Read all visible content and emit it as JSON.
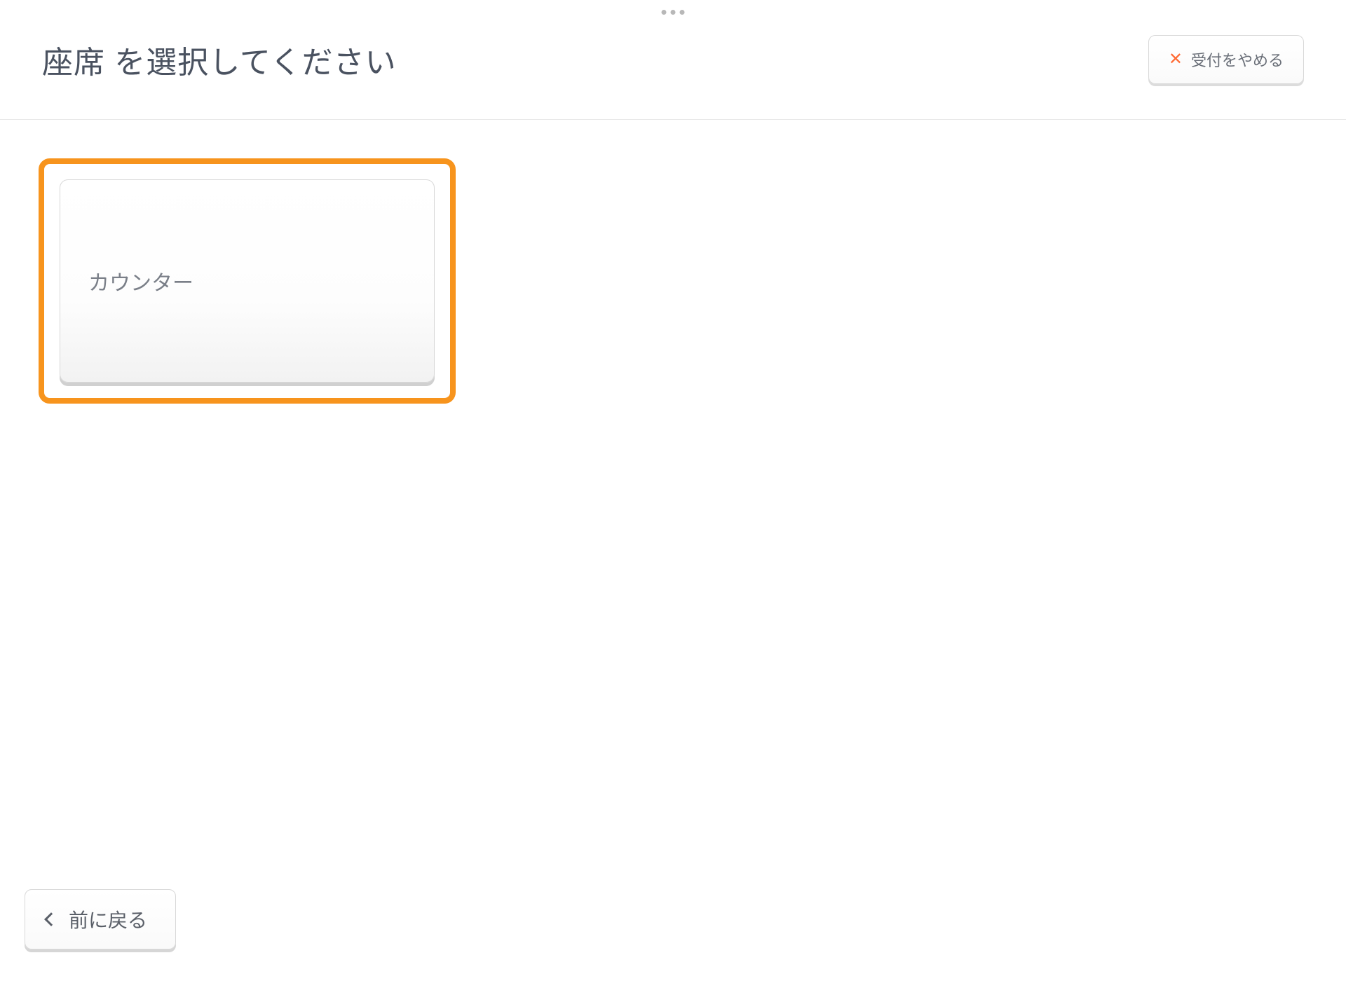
{
  "header": {
    "title": "座席 を選択してください",
    "cancel_label": "受付をやめる"
  },
  "seats": [
    {
      "label": "カウンター"
    }
  ],
  "footer": {
    "back_label": "前に戻る"
  }
}
